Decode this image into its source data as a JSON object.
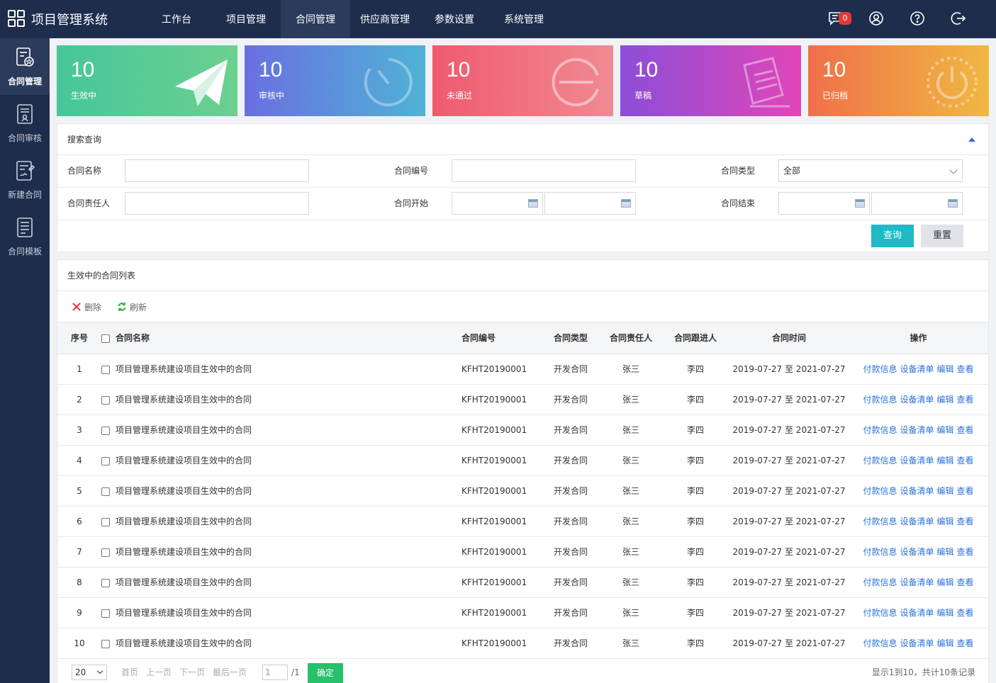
{
  "app": {
    "title": "项目管理系统"
  },
  "nav": [
    {
      "label": "工作台"
    },
    {
      "label": "项目管理"
    },
    {
      "label": "合同管理"
    },
    {
      "label": "供应商管理"
    },
    {
      "label": "参数设置"
    },
    {
      "label": "系统管理"
    }
  ],
  "notifications": {
    "count": "0"
  },
  "sidebar": [
    {
      "label": "合同管理"
    },
    {
      "label": "合同审核"
    },
    {
      "label": "新建合同"
    },
    {
      "label": "合同模板"
    }
  ],
  "stats": [
    {
      "count": "10",
      "label": "生效中",
      "icon": "paper-plane-icon"
    },
    {
      "count": "10",
      "label": "审核中",
      "icon": "timer-icon"
    },
    {
      "count": "10",
      "label": "未通过",
      "icon": "minus-circle-icon"
    },
    {
      "count": "10",
      "label": "草稿",
      "icon": "document-icon"
    },
    {
      "count": "10",
      "label": "已归档",
      "icon": "power-icon"
    }
  ],
  "search": {
    "title": "搜索查询",
    "name_label": "合同名称",
    "number_label": "合同编号",
    "type_label": "合同类型",
    "type_value": "全部",
    "owner_label": "合同责任人",
    "start_label": "合同开始",
    "end_label": "合同结束",
    "query_button": "查询",
    "reset_button": "重置"
  },
  "list": {
    "title": "生效中的合同列表",
    "delete_label": "删除",
    "refresh_label": "刷新",
    "headers": {
      "index": "序号",
      "name": "合同名称",
      "number": "合同编号",
      "type": "合同类型",
      "owner": "合同责任人",
      "follower": "合同跟进人",
      "time": "合同时间",
      "ops": "操作"
    },
    "ops": {
      "pay": "付款信息",
      "equip": "设备清单",
      "edit": "编辑",
      "view": "查看"
    },
    "rows": [
      {
        "index": "1",
        "name": "项目管理系统建设项目生效中的合同",
        "number": "KFHT20190001",
        "type": "开发合同",
        "owner": "张三",
        "follower": "李四",
        "time": "2019-07-27 至 2021-07-27"
      },
      {
        "index": "2",
        "name": "项目管理系统建设项目生效中的合同",
        "number": "KFHT20190001",
        "type": "开发合同",
        "owner": "张三",
        "follower": "李四",
        "time": "2019-07-27 至 2021-07-27"
      },
      {
        "index": "3",
        "name": "项目管理系统建设项目生效中的合同",
        "number": "KFHT20190001",
        "type": "开发合同",
        "owner": "张三",
        "follower": "李四",
        "time": "2019-07-27 至 2021-07-27"
      },
      {
        "index": "4",
        "name": "项目管理系统建设项目生效中的合同",
        "number": "KFHT20190001",
        "type": "开发合同",
        "owner": "张三",
        "follower": "李四",
        "time": "2019-07-27 至 2021-07-27"
      },
      {
        "index": "5",
        "name": "项目管理系统建设项目生效中的合同",
        "number": "KFHT20190001",
        "type": "开发合同",
        "owner": "张三",
        "follower": "李四",
        "time": "2019-07-27 至 2021-07-27"
      },
      {
        "index": "6",
        "name": "项目管理系统建设项目生效中的合同",
        "number": "KFHT20190001",
        "type": "开发合同",
        "owner": "张三",
        "follower": "李四",
        "time": "2019-07-27 至 2021-07-27"
      },
      {
        "index": "7",
        "name": "项目管理系统建设项目生效中的合同",
        "number": "KFHT20190001",
        "type": "开发合同",
        "owner": "张三",
        "follower": "李四",
        "time": "2019-07-27 至 2021-07-27"
      },
      {
        "index": "8",
        "name": "项目管理系统建设项目生效中的合同",
        "number": "KFHT20190001",
        "type": "开发合同",
        "owner": "张三",
        "follower": "李四",
        "time": "2019-07-27 至 2021-07-27"
      },
      {
        "index": "9",
        "name": "项目管理系统建设项目生效中的合同",
        "number": "KFHT20190001",
        "type": "开发合同",
        "owner": "张三",
        "follower": "李四",
        "time": "2019-07-27 至 2021-07-27"
      },
      {
        "index": "10",
        "name": "项目管理系统建设项目生效中的合同",
        "number": "KFHT20190001",
        "type": "开发合同",
        "owner": "张三",
        "follower": "李四",
        "time": "2019-07-27 至 2021-07-27"
      }
    ]
  },
  "pager": {
    "page_size": "20",
    "first": "首页",
    "prev": "上一页",
    "next": "下一页",
    "last": "最后一页",
    "page_input": "1",
    "total_pages": "/1",
    "go": "确定",
    "info": "显示1到10，共计10条记录"
  }
}
